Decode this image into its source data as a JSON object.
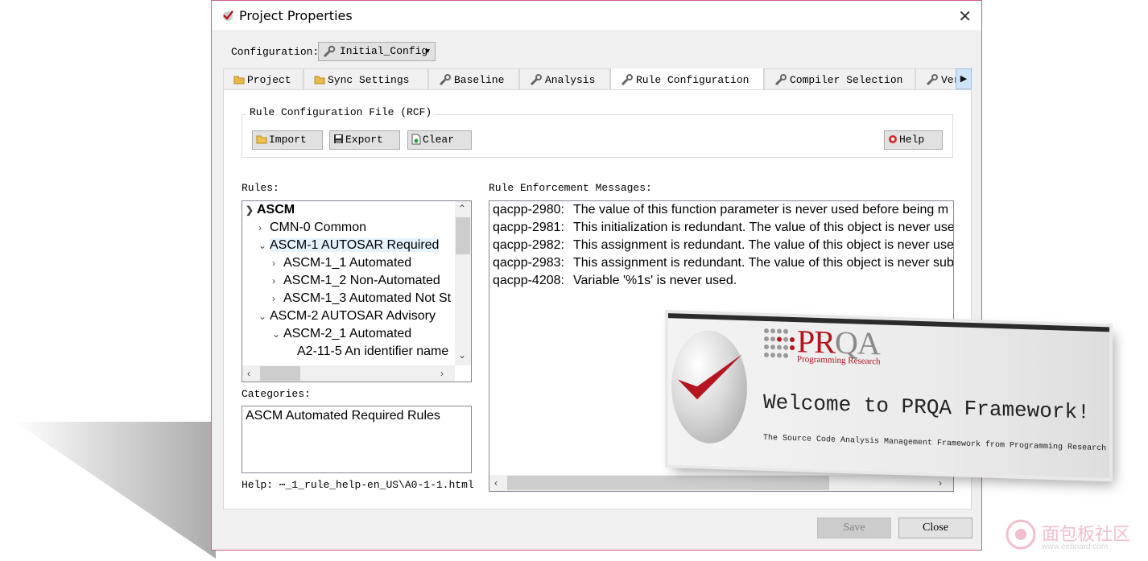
{
  "window": {
    "title": "Project Properties"
  },
  "configuration": {
    "label": "Configuration:",
    "value": "Initial_Config"
  },
  "tabs": [
    {
      "label": "Project",
      "icon": "folder-icon"
    },
    {
      "label": "Sync Settings",
      "icon": "folder-icon"
    },
    {
      "label": "Baseline",
      "icon": "wrench-icon"
    },
    {
      "label": "Analysis",
      "icon": "wrench-icon"
    },
    {
      "label": "Rule Configuration",
      "icon": "wrench-icon",
      "active": true
    },
    {
      "label": "Compiler Selection",
      "icon": "wrench-icon"
    },
    {
      "label": "Vers:",
      "icon": "wrench-icon"
    }
  ],
  "rcf": {
    "group_title": "Rule Configuration File (RCF)",
    "import_label": "Import",
    "export_label": "Export",
    "clear_label": "Clear",
    "help_label": "Help"
  },
  "rules": {
    "label": "Rules:",
    "items": [
      {
        "text": "ASCM",
        "level": 0,
        "chevron": "down",
        "bold": true
      },
      {
        "text": "CMN-0 Common",
        "level": 1,
        "chevron": "right"
      },
      {
        "text": "ASCM-1 AUTOSAR Required",
        "level": 1,
        "chevron": "down",
        "selected": true
      },
      {
        "text": "ASCM-1_1 Automated",
        "level": 2,
        "chevron": "right"
      },
      {
        "text": "ASCM-1_2 Non-Automated",
        "level": 2,
        "chevron": "right"
      },
      {
        "text": "ASCM-1_3 Automated Not St",
        "level": 2,
        "chevron": "right"
      },
      {
        "text": "ASCM-2 AUTOSAR Advisory",
        "level": 1,
        "chevron": "down"
      },
      {
        "text": "ASCM-2_1 Automated",
        "level": 2,
        "chevron": "down"
      },
      {
        "text": "A2-11-5 An identifier name",
        "level": 3,
        "chevron": ""
      }
    ]
  },
  "categories": {
    "label": "Categories:",
    "value": "ASCM Automated Required Rules"
  },
  "help_path": "Help: ⋯_1_rule_help-en_US\\A0-1-1.html",
  "messages": {
    "label": "Rule Enforcement Messages:",
    "items": [
      {
        "code": "qacpp-2980:",
        "text": "The value of this function parameter is never used before being m"
      },
      {
        "code": "qacpp-2981:",
        "text": "This initialization is redundant. The value of this object is never use"
      },
      {
        "code": "qacpp-2982:",
        "text": "This assignment is redundant. The value of this object is never use"
      },
      {
        "code": "qacpp-2983:",
        "text": "This assignment is redundant. The value of this object is never sub"
      },
      {
        "code": "qacpp-4208:",
        "text": "Variable '%1s' is never used."
      }
    ]
  },
  "footer": {
    "save_label": "Save",
    "close_label": "Close"
  },
  "splash": {
    "logo_pr": "PR",
    "logo_qa": "QA",
    "logo_sub": "Programming Research",
    "welcome": "Welcome to PRQA Framework!",
    "tagline": "The Source Code Analysis Management Framework from Programming Research Ltd"
  },
  "watermark": {
    "text": "面包板社区",
    "url": "www.eeboard.com"
  },
  "colors": {
    "accent_border": "#d15c8c",
    "selection": "#e5f3ff",
    "brand_red": "#b4151e"
  }
}
